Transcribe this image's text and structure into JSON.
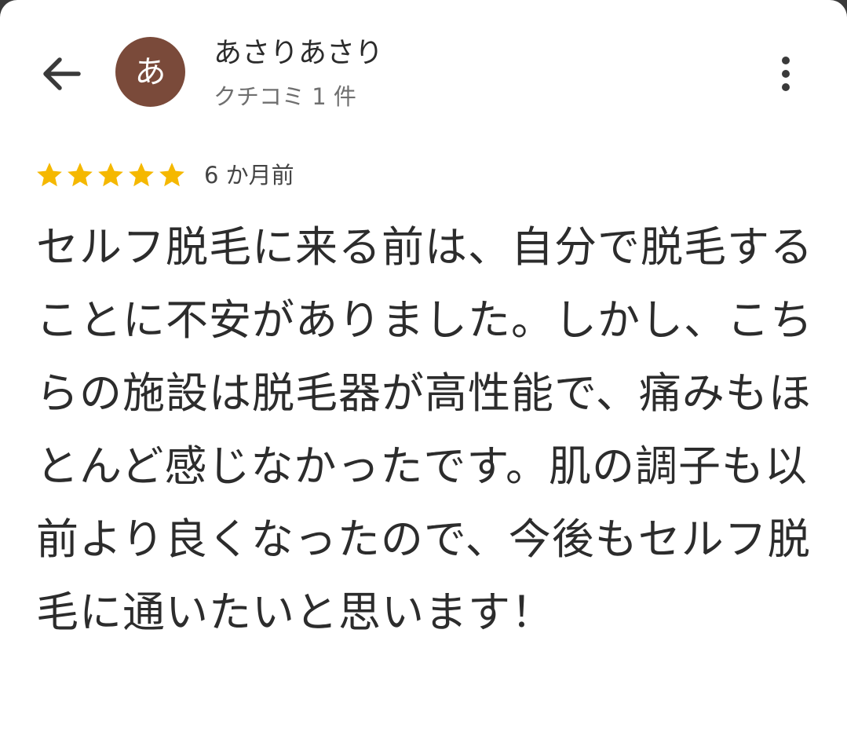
{
  "header": {
    "back_icon": "arrow-left-icon",
    "avatar_initial": "あ",
    "avatar_color": "#7a4a3a",
    "user_name": "あさりあさり",
    "review_count": "クチコミ 1 件",
    "more_icon": "more-vert-icon"
  },
  "review": {
    "rating": 5,
    "rating_max": 5,
    "star_color": "#f5b800",
    "date": "6 か月前",
    "text": "セルフ脱毛に来る前は、自分で脱毛することに不安がありました。しかし、こちらの施設は脱毛器が高性能で、痛みもほとんど感じなかったです。肌の調子も以前より良くなったので、今後もセルフ脱毛に通いたいと思います！"
  }
}
